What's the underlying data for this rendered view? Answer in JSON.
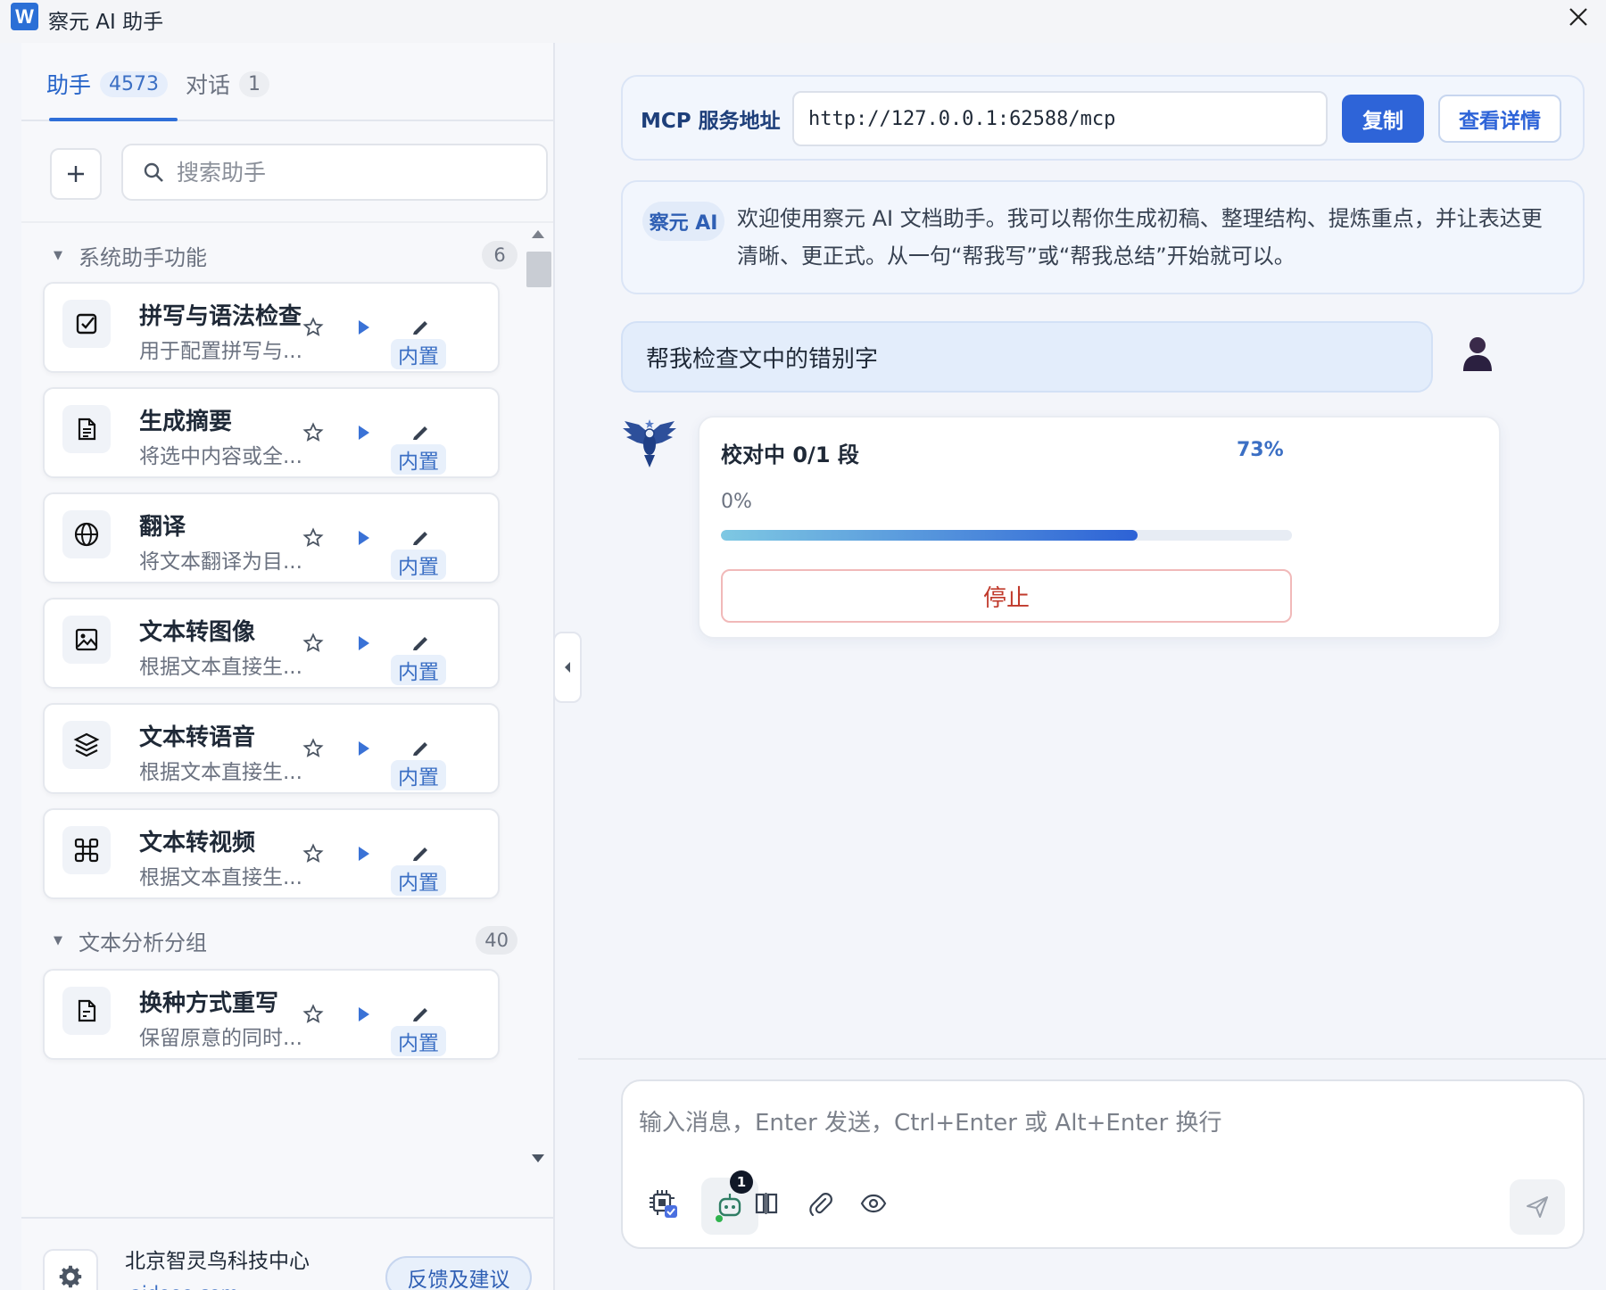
{
  "window": {
    "title": "察元 AI 助手",
    "logo_letter": "W",
    "accent": "#2e64d8"
  },
  "tabs": [
    {
      "label": "助手",
      "count": "4573",
      "active": true
    },
    {
      "label": "对话",
      "count": "1",
      "active": false
    }
  ],
  "search": {
    "placeholder": "搜索助手"
  },
  "groups": [
    {
      "name": "系统助手功能",
      "count": "6",
      "items": [
        {
          "title": "拼写与语法检查",
          "desc": "用于配置拼写与...",
          "badge": "内置",
          "icon": "check-square-icon"
        },
        {
          "title": "生成摘要",
          "desc": "将选中内容或全...",
          "badge": "内置",
          "icon": "document-icon"
        },
        {
          "title": "翻译",
          "desc": "将文本翻译为目...",
          "badge": "内置",
          "icon": "globe-icon"
        },
        {
          "title": "文本转图像",
          "desc": "根据文本直接生...",
          "badge": "内置",
          "icon": "image-icon"
        },
        {
          "title": "文本转语音",
          "desc": "根据文本直接生...",
          "badge": "内置",
          "icon": "layers-icon"
        },
        {
          "title": "文本转视频",
          "desc": "根据文本直接生...",
          "badge": "内置",
          "icon": "nodes-icon"
        }
      ]
    },
    {
      "name": "文本分析分组",
      "count": "40",
      "items": [
        {
          "title": "换种方式重写",
          "desc": "保留原意的同时...",
          "badge": "内置",
          "icon": "file-edit-icon"
        }
      ]
    }
  ],
  "footer": {
    "company": "北京智灵鸟科技中心",
    "site": "aidooo.com",
    "feedback": "反馈及建议"
  },
  "mcp": {
    "label": "MCP 服务地址",
    "url": "http://127.0.0.1:62588/mcp",
    "copy": "复制",
    "details": "查看详情"
  },
  "welcome": {
    "badge": "察元 AI",
    "text": "欢迎使用察元 AI 文档助手。我可以帮你生成初稿、整理结构、提炼重点，并让表达更清晰、更正式。从一句“帮我写”或“帮我总结”开始就可以。"
  },
  "user_message": "帮我检查文中的错别字",
  "progress": {
    "title": "校对中 0/1 段",
    "percent_label": "73%",
    "sub_label": "0%",
    "value": 0.73,
    "stop": "停止"
  },
  "composer": {
    "placeholder": "输入消息，Enter 发送，Ctrl+Enter 或 Alt+Enter 换行",
    "bot_badge": "1",
    "tools": [
      "chip-icon",
      "bot-icon",
      "columns-icon",
      "paperclip-icon",
      "eye-icon",
      "send-icon"
    ]
  }
}
